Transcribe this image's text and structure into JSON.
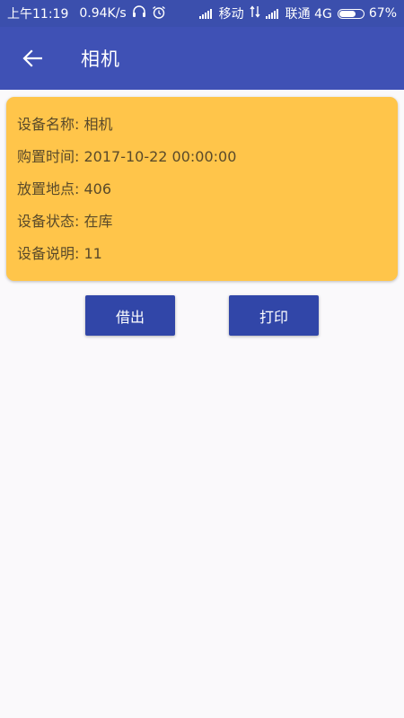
{
  "status_bar": {
    "time": "上午11:19",
    "net_speed": "0.94K/s",
    "carrier1": "移动",
    "carrier2": "联通 4G",
    "battery": "67%",
    "icons": [
      "headphones-icon",
      "alarm-icon",
      "signal-icon",
      "data-transfer-icon",
      "battery-icon"
    ]
  },
  "app_bar": {
    "back_icon": "arrow-back-icon",
    "title": "相机"
  },
  "device": {
    "name_row": "设备名称: 相机",
    "purchase_row": "购置时间: 2017-10-22 00:00:00",
    "location_row": "放置地点: 406",
    "status_row": "设备状态: 在库",
    "desc_row": "设备说明: 11"
  },
  "actions": {
    "borrow_label": "借出",
    "print_label": "打印"
  },
  "colors": {
    "status_bar": "#3b4fad",
    "app_bar": "#3f51b5",
    "card": "#ffc54a",
    "button": "#3146a8",
    "background": "#faf9fb"
  }
}
